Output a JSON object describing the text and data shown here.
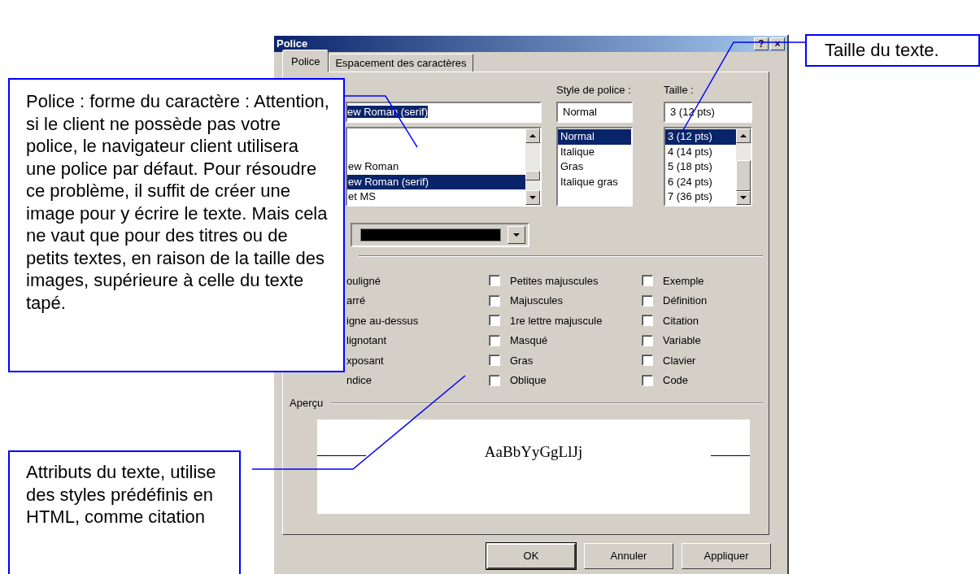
{
  "window": {
    "title": "Police",
    "controls": [
      "?",
      "×"
    ]
  },
  "tabs": [
    {
      "label": "Police",
      "selected": true
    },
    {
      "label": "Espacement des caractères",
      "selected": false
    }
  ],
  "font": {
    "value": "ew Roman (serif)",
    "items": [
      {
        "label": "ew Roman",
        "selected": false
      },
      {
        "label": "ew Roman (serif)",
        "selected": true
      },
      {
        "label": "et MS",
        "selected": false
      }
    ]
  },
  "style": {
    "label": "Style de police :",
    "value": "Normal",
    "items": [
      {
        "label": "Normal",
        "selected": true
      },
      {
        "label": "Italique",
        "selected": false
      },
      {
        "label": "Gras",
        "selected": false
      },
      {
        "label": "Italique gras",
        "selected": false
      }
    ]
  },
  "size": {
    "label": "Taille :",
    "value": "3  (12 pts)",
    "items": [
      {
        "label": "3  (12 pts)",
        "selected": true
      },
      {
        "label": "4  (14 pts)",
        "selected": false
      },
      {
        "label": "5  (18 pts)",
        "selected": false
      },
      {
        "label": "6  (24 pts)",
        "selected": false
      },
      {
        "label": "7  (36 pts)",
        "selected": false
      }
    ]
  },
  "effect_columns": [
    {
      "items": [
        {
          "kind": "label",
          "label": "ouligné"
        },
        {
          "kind": "label",
          "label": "arré"
        },
        {
          "kind": "label",
          "label": "igne au-dessus"
        },
        {
          "kind": "label",
          "label": "lignotant"
        },
        {
          "kind": "label",
          "label": "xposant"
        },
        {
          "kind": "label",
          "label": "ndice"
        }
      ]
    },
    {
      "items": [
        {
          "kind": "checkbox",
          "label": "Petites majuscules",
          "checked": false
        },
        {
          "kind": "checkbox",
          "label": "Majuscules",
          "checked": false
        },
        {
          "kind": "checkbox",
          "label": "1re lettre majuscule",
          "checked": false
        },
        {
          "kind": "checkbox",
          "label": "Masqué",
          "checked": false
        },
        {
          "kind": "checkbox",
          "label": "Gras",
          "checked": false
        },
        {
          "kind": "checkbox",
          "label": "Oblique",
          "checked": false
        }
      ]
    },
    {
      "items": [
        {
          "kind": "checkbox",
          "label": "Exemple",
          "checked": false
        },
        {
          "kind": "checkbox",
          "label": "Définition",
          "checked": false
        },
        {
          "kind": "checkbox",
          "label": "Citation",
          "checked": false
        },
        {
          "kind": "checkbox",
          "label": "Variable",
          "checked": false
        },
        {
          "kind": "checkbox",
          "label": "Clavier",
          "checked": false
        },
        {
          "kind": "checkbox",
          "label": "Code",
          "checked": false
        }
      ]
    }
  ],
  "preview": {
    "label": "Aperçu",
    "sample": "AaBbYyGgLlJj"
  },
  "buttons": [
    {
      "label": "OK",
      "default": true
    },
    {
      "label": "Annuler",
      "default": false
    },
    {
      "label": "Appliquer",
      "default": false
    }
  ],
  "callouts": [
    {
      "text": "Police : forme du caractère : Attention, si le client ne possède pas votre police, le navigateur client utilisera une police par défaut. Pour résoudre ce problème, il suffit de créer une image pour y écrire le texte. Mais cela ne vaut que pour des titres ou de petits textes, en raison de la taille des images, supérieure à celle du texte tapé."
    },
    {
      "text": "Taille du texte."
    },
    {
      "text": "Attributs du texte, utilise des styles prédéfinis en HTML, comme citation"
    }
  ]
}
